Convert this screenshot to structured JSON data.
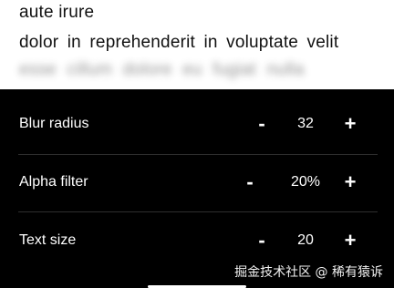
{
  "preview": {
    "line1": "aute irure",
    "line2": "dolor in reprehenderit in voluptate velit",
    "line3": "esse cillum dolore eu fugiat nulla"
  },
  "settings": [
    {
      "label": "Blur radius",
      "value": "32",
      "minus": "-",
      "plus": "+"
    },
    {
      "label": "Alpha filter",
      "value": "20%",
      "minus": "-",
      "plus": "+"
    },
    {
      "label": "Text size",
      "value": "20",
      "minus": "-",
      "plus": "+"
    }
  ],
  "watermark": "掘金技术社区 @ 稀有猿诉"
}
